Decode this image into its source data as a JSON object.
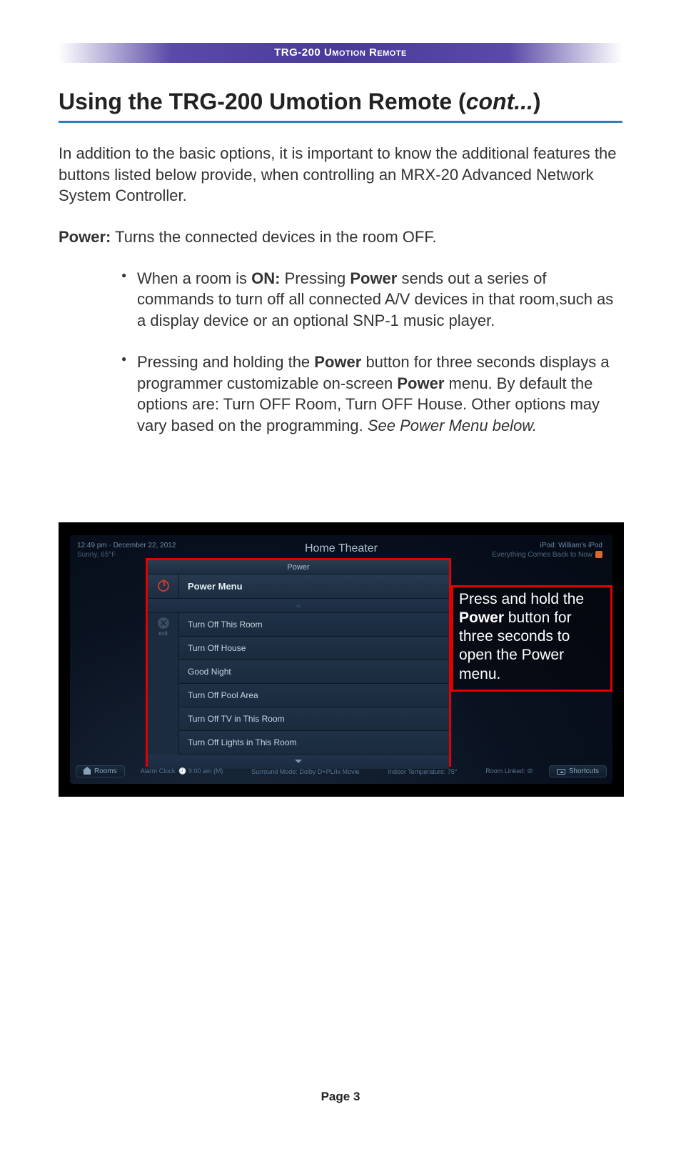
{
  "header_band": "TRG-200 Umotion Remote",
  "heading_main": "Using the TRG-200 Umotion Remote ",
  "heading_paren_open": "(",
  "heading_cont": "cont...",
  "heading_paren_close": ")",
  "intro": "In addition to the basic options, it is important to know the additional features the buttons listed below provide, when controlling an MRX-20 Advanced Network System Controller.",
  "power_label": "Power:",
  "power_desc": " Turns the connected devices in the room OFF.",
  "b1_a": "When a room is ",
  "b1_b": "ON:",
  "b1_c": " Pressing ",
  "b1_d": "Power",
  "b1_e": " sends out a series of commands to turn off all connected A/V devices in that room,such as a display device or an optional SNP-1 music player.",
  "b2_a": "Pressing and holding the ",
  "b2_b": "Power",
  "b2_c": " button for three seconds displays a programmer customizable on-screen ",
  "b2_d": "Power",
  "b2_e": " menu. By default the options are: Turn OFF Room, Turn OFF House. Other options may vary based on the programming. ",
  "b2_f": "See Power Menu below.",
  "shot": {
    "datetime": "12:49 pm · December 22, 2012",
    "weather": "Sunny, 65°F",
    "room": "Home Theater",
    "ipod_label": "iPod: William's iPod",
    "now_playing": "Everything Comes Back to Now",
    "panel_tab": "Power",
    "panel_title": "Power Menu",
    "exit": "exit",
    "items": [
      "Turn Off This Room",
      "Turn Off House",
      "Good Night",
      "Turn Off Pool Area",
      "Turn Off TV in This Room",
      "Turn Off Lights in This Room"
    ],
    "callout_a": "Press and hold the ",
    "callout_b": "Power",
    "callout_c": " button for three seconds to open the Power menu.",
    "rooms": "Rooms",
    "alarm": "Alarm Clock:",
    "alarm_val": "9:00 am (M)",
    "surround": "Surround Mode: Dolby D+PLIIx Movie",
    "indoor": "Indoor Temperature: 75°",
    "linked": "Room Linked:",
    "shortcuts": "Shortcuts"
  },
  "page_no": "Page 3"
}
